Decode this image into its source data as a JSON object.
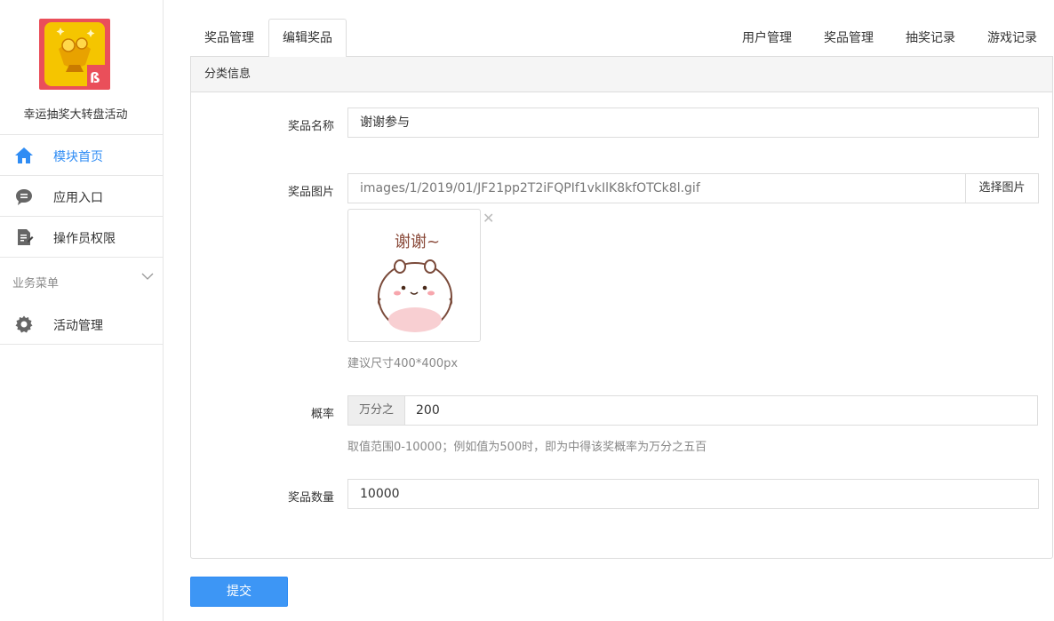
{
  "sidebar": {
    "app_name": "幸运抽奖大转盘活动",
    "items": [
      {
        "label": "模块首页",
        "icon": "home-icon",
        "active": true
      },
      {
        "label": "应用入口",
        "icon": "chat-bubble-icon",
        "active": false
      },
      {
        "label": "操作员权限",
        "icon": "document-edit-icon",
        "active": false
      }
    ],
    "section_label": "业务菜单",
    "section_items": [
      {
        "label": "活动管理",
        "icon": "gear-icon"
      }
    ]
  },
  "tabs_left": [
    {
      "label": "奖品管理",
      "active": false
    },
    {
      "label": "编辑奖品",
      "active": true
    }
  ],
  "tabs_right": [
    {
      "label": "用户管理"
    },
    {
      "label": "奖品管理"
    },
    {
      "label": "抽奖记录"
    },
    {
      "label": "游戏记录"
    }
  ],
  "panel": {
    "title": "分类信息",
    "prize_name": {
      "label": "奖品名称",
      "value": "谢谢参与"
    },
    "prize_image": {
      "label": "奖品图片",
      "path": "images/1/2019/01/JF21pp2T2iFQPIf1vkIlK8kfOTCk8l.gif",
      "button": "选择图片",
      "close": "✕",
      "image_caption": "谢谢~",
      "hint": "建议尺寸400*400px"
    },
    "probability": {
      "label": "概率",
      "addon": "万分之",
      "value": "200",
      "hint": "取值范围0-10000；例如值为500时，即为中得该奖概率为万分之五百"
    },
    "quantity": {
      "label": "奖品数量",
      "value": "10000"
    }
  },
  "submit_label": "提交",
  "colors": {
    "accent": "#2f8cf4",
    "submit": "#3d96f5",
    "logo_bg": "#ea4f5a",
    "logo_inner": "#f5c500"
  }
}
